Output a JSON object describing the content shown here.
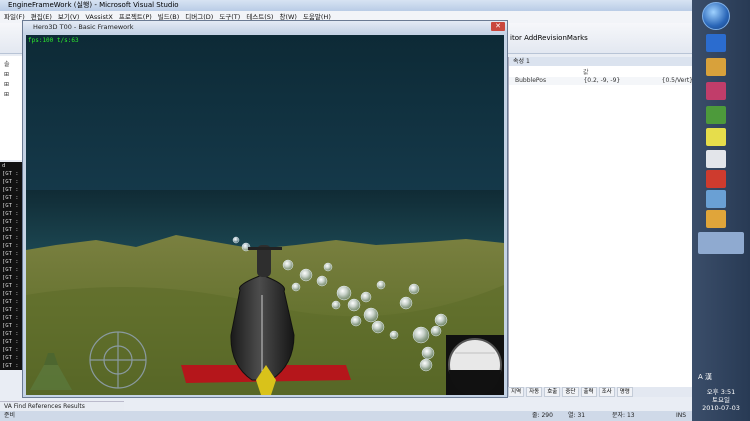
{
  "vs": {
    "title": "EngineFrameWork (실행) - Microsoft Visual Studio",
    "menu": [
      "파일(F)",
      "편집(E)",
      "보기(V)",
      "VAssistX",
      "프로젝트(P)",
      "빌드(B)",
      "디버그(D)",
      "도구(T)",
      "테스트(S)",
      "창(W)",
      "도움말(H)"
    ],
    "toolbar_text": "itor AddRevisionMarks",
    "properties": {
      "header": "속성 1",
      "col_name": "",
      "col_value": "값",
      "row_name": "BubblePos",
      "row_value": "{0.2, -9, -9}",
      "row_extra": "{0.5/Vert}"
    },
    "left_tree": [
      "솔",
      "⊞",
      "⊞",
      "⊞"
    ],
    "console_lines": [
      "[GT :",
      "[GT :",
      "[GT :",
      "[GT :",
      "[GT :",
      "[GT :",
      "[GT :",
      "[GT :",
      "[GT :",
      "[GT :",
      "[GT :",
      "[GT :",
      "[GT :",
      "[GT :",
      "[GT :",
      "[GT :",
      "[GT :",
      "[GT :",
      "[GT :",
      "[GT :",
      "[GT :",
      "[GT :",
      "[GT :",
      "[GT :",
      "[GT :"
    ],
    "console_tab": "d",
    "props_tabs": [
      "지역",
      "자동",
      "호출",
      "중단",
      "출력",
      "조사",
      "명령"
    ],
    "find_tab": "VA Find References Results",
    "status": {
      "ready": "준비",
      "line": "줄: 290",
      "col": "열: 31",
      "char": "문자: 13",
      "mode": "INS"
    }
  },
  "game": {
    "title": "Hero3D T00 - Basic Framework",
    "fps": "fps:100 t/s:63",
    "close": "✕",
    "colors": {
      "sky": "#11313d",
      "sea": "#0f2a32",
      "terrain": "#6e7a38",
      "plane_body": "#2a2a2a",
      "wing": "#b5161b"
    }
  },
  "taskbar": {
    "time": "오후 3:51",
    "day": "토요일",
    "date": "2010-07-03",
    "lang": "A 漢",
    "icons": [
      "ie-icon",
      "explorer-icon",
      "paint-icon",
      "notepad-icon",
      "app-icon",
      "star-icon",
      "window-icon",
      "chat-icon",
      "vs-icon"
    ]
  }
}
